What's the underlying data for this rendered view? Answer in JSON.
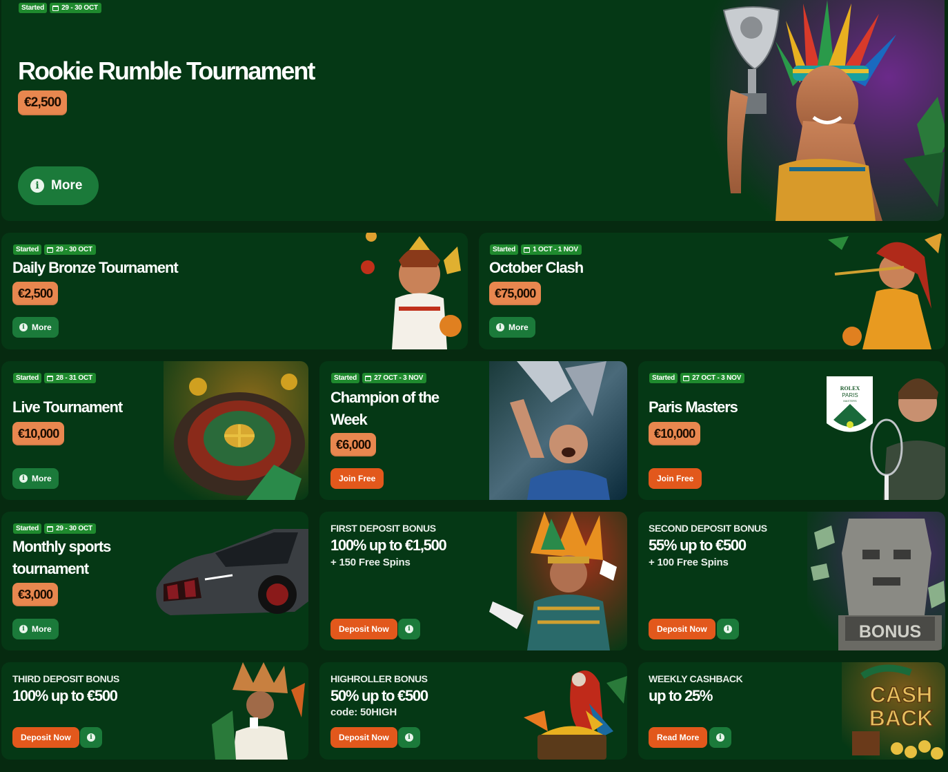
{
  "hero": {
    "status": "Started",
    "dates": "29 - 30 OCT",
    "title": "Rookie Rumble Tournament",
    "prize": "€2,500",
    "more_label": "More"
  },
  "tournaments": [
    {
      "status": "Started",
      "dates": "29 - 30 OCT",
      "title": "Daily Bronze Tournament",
      "prize": "€2,500",
      "button": "More"
    },
    {
      "status": "Started",
      "dates": "1 OCT - 1 NOV",
      "title": "October Clash",
      "prize": "€75,000",
      "button": "More"
    },
    {
      "status": "Started",
      "dates": "28 - 31 OCT",
      "title": "Live Tournament",
      "prize": "€10,000",
      "button": "More"
    },
    {
      "status": "Started",
      "dates": "27 OCT - 3 NOV",
      "title_line1": "Champion of the",
      "title_line2": "Week",
      "prize": "€6,000",
      "button": "Join Free"
    },
    {
      "status": "Started",
      "dates": "27 OCT - 3 NOV",
      "title": "Paris Masters",
      "prize": "€10,000",
      "button": "Join Free"
    },
    {
      "status": "Started",
      "dates": "29 - 30 OCT",
      "title_line1": "Monthly sports",
      "title_line2": "tournament",
      "prize": "€3,000",
      "button": "More"
    }
  ],
  "bonuses": [
    {
      "label": "FIRST DEPOSIT BONUS",
      "title": "100% up to €1,500",
      "subtitle": "+ 150 Free Spins",
      "button": "Deposit Now"
    },
    {
      "label": "SECOND DEPOSIT BONUS",
      "title": "55% up to €500",
      "subtitle": "+ 100 Free Spins",
      "button": "Deposit Now"
    },
    {
      "label": "THIRD DEPOSIT BONUS",
      "title": "100% up to €500",
      "button": "Deposit Now"
    },
    {
      "label": "HIGHROLLER BONUS",
      "title": "50% up to €500",
      "subtitle": "code: 50HIGH",
      "button": "Deposit Now"
    },
    {
      "label": "WEEKLY CASHBACK",
      "title": "up to 25%",
      "button": "Read More"
    }
  ],
  "art_text": {
    "rolex": "ROLEX",
    "paris": "PARIS",
    "masters": "MASTERS",
    "bonus": "BONUS",
    "cash": "CASH",
    "back": "BACK"
  },
  "colors": {
    "card_bg": "#053815",
    "page_bg": "#062a10",
    "badge_green": "#1f8a2e",
    "prize_orange": "#e8874f",
    "button_orange": "#e2581c",
    "button_green": "#1b7a3a"
  },
  "icons": [
    "calendar-icon",
    "info-icon"
  ]
}
